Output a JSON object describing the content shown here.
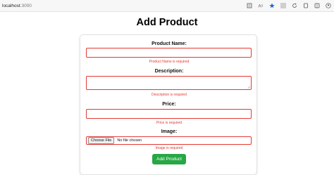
{
  "browser": {
    "host": "localhost",
    "port": ":3000"
  },
  "page": {
    "title": "Add Product"
  },
  "form": {
    "name_label": "Product Name:",
    "name_error": "Product Name is required",
    "description_label": "Description:",
    "description_error": "Description is required",
    "price_label": "Price:",
    "price_error": "Price is required",
    "image_label": "Image:",
    "choose_file": "Choose File",
    "no_file": "No file chosen",
    "image_error": "Image is required",
    "submit_label": "Add Product"
  },
  "colors": {
    "error": "#e53935",
    "submit": "#28a745"
  }
}
